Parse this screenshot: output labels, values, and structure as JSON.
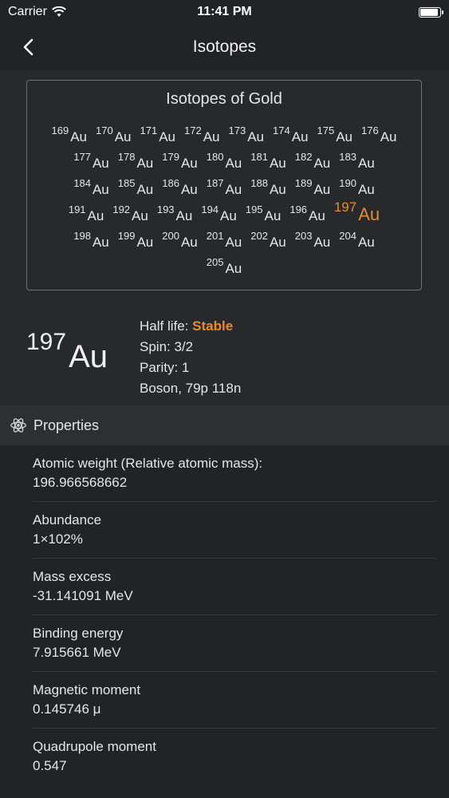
{
  "status": {
    "carrier": "Carrier",
    "time": "11:41 PM"
  },
  "nav": {
    "title": "Isotopes"
  },
  "isotopes": {
    "title": "Isotopes of Gold",
    "symbol": "Au",
    "selected": "197",
    "rows": [
      [
        "169",
        "170",
        "171",
        "172",
        "173",
        "174",
        "175",
        "176"
      ],
      [
        "177",
        "178",
        "179",
        "180",
        "181",
        "182",
        "183"
      ],
      [
        "184",
        "185",
        "186",
        "187",
        "188",
        "189",
        "190"
      ],
      [
        "191",
        "192",
        "193",
        "194",
        "195",
        "196",
        "197"
      ],
      [
        "198",
        "199",
        "200",
        "201",
        "202",
        "203",
        "204"
      ],
      [
        "205"
      ]
    ]
  },
  "detail": {
    "mass": "197",
    "symbol": "Au",
    "half_life_label": "Half life:",
    "half_life_value": "Stable",
    "spin": "Spin: 3/2",
    "parity": "Parity: 1",
    "composition": "Boson, 79p 118n"
  },
  "properties": {
    "title": "Properties",
    "items": [
      {
        "label": "Atomic weight (Relative atomic mass):",
        "value": "196.966568662"
      },
      {
        "label": "Abundance",
        "value": "1×102%"
      },
      {
        "label": "Mass excess",
        "value": "-31.141091 MeV"
      },
      {
        "label": "Binding energy",
        "value": "7.915661 MeV"
      },
      {
        "label": "Magnetic moment",
        "value": "0.145746 μ"
      },
      {
        "label": "Quadrupole moment",
        "value": "0.547"
      }
    ]
  },
  "colors": {
    "accent": "#e88b2e",
    "background": "#222326",
    "panel": "#28292d"
  }
}
